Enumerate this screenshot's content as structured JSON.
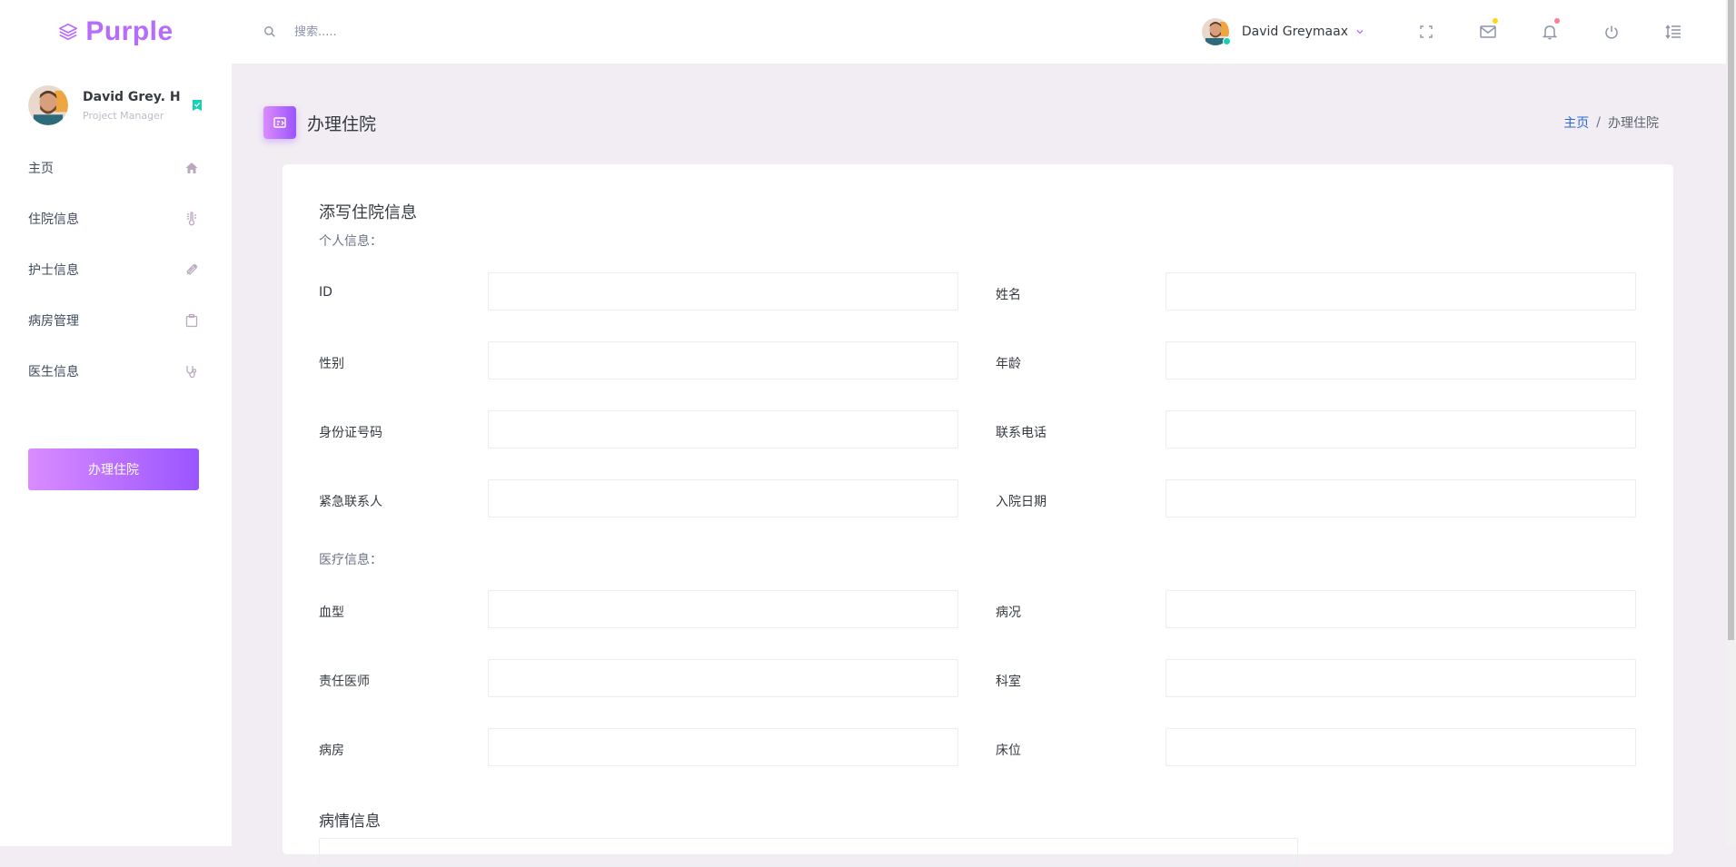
{
  "navbar": {
    "brand": "Purple",
    "search_placeholder": "搜索.....",
    "user_name": "David Greymaax"
  },
  "sidebar": {
    "profile_name": "David Grey. H",
    "profile_role": "Project Manager",
    "items": [
      {
        "label": "主页",
        "icon": "home-icon"
      },
      {
        "label": "住院信息",
        "icon": "thermometer-icon"
      },
      {
        "label": "护士信息",
        "icon": "syringe-icon"
      },
      {
        "label": "病房管理",
        "icon": "clipboard-icon"
      },
      {
        "label": "医生信息",
        "icon": "stethoscope-icon"
      }
    ],
    "action_button": "办理住院"
  },
  "page": {
    "title": "办理住院",
    "breadcrumb": {
      "home": "主页",
      "separator": "/",
      "current": "办理住院"
    }
  },
  "form": {
    "title": "添写住院信息",
    "personal_section": "个人信息：",
    "medical_section": "医疗信息：",
    "fields": {
      "id": "ID",
      "name": "姓名",
      "gender": "性别",
      "age": "年龄",
      "id_number": "身份证号码",
      "phone": "联系电话",
      "emergency_contact": "紧急联系人",
      "admission_date": "入院日期",
      "blood_type": "血型",
      "condition": "病况",
      "doctor": "责任医师",
      "department": "科室",
      "ward": "病房",
      "bed": "床位"
    },
    "illness_heading": "病情信息"
  },
  "colors": {
    "brand": "#b66dff",
    "gradient_start": "#da8cff",
    "gradient_end": "#9a55ff",
    "online": "#1bcfb4",
    "link": "#2a6ad6"
  }
}
